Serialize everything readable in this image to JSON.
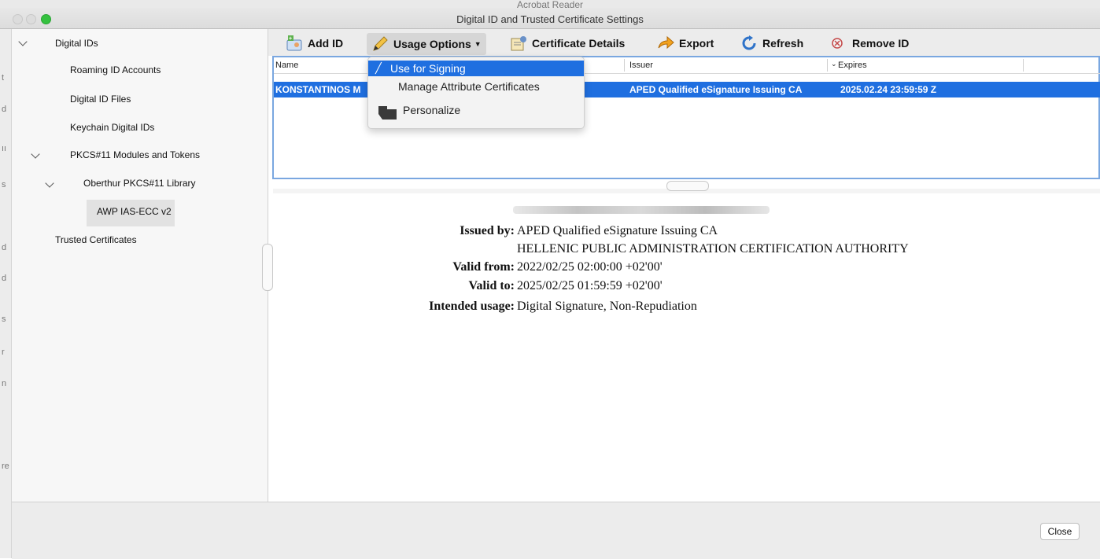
{
  "window": {
    "background_app_title": "Acrobat Reader",
    "title": "Digital ID and Trusted Certificate Settings"
  },
  "left_strip_chars": [
    "t",
    "d",
    "ıı",
    "s",
    "d",
    "d",
    "s",
    "r",
    "n",
    "re"
  ],
  "sidebar": {
    "items": [
      {
        "label": "Digital IDs"
      },
      {
        "label": "Roaming ID Accounts"
      },
      {
        "label": "Digital ID Files"
      },
      {
        "label": "Keychain Digital IDs"
      },
      {
        "label": "PKCS#11 Modules and Tokens"
      },
      {
        "label": "Oberthur PKCS#11 Library"
      },
      {
        "label": "AWP IAS-ECC v2"
      },
      {
        "label": "Trusted Certificates"
      }
    ]
  },
  "toolbar": {
    "add_id": "Add ID",
    "usage_options": "Usage Options",
    "certificate_details": "Certificate Details",
    "export": "Export",
    "refresh": "Refresh",
    "remove_id": "Remove ID"
  },
  "list": {
    "columns": [
      "Name",
      "Issuer",
      "Expires"
    ],
    "rows": [
      {
        "name": "KONSTANTINOS M",
        "issuer": "APED Qualified eSignature Issuing CA",
        "expires": "2025.02.24 23:59:59 Z"
      }
    ]
  },
  "menu": {
    "items": [
      "Use for Signing",
      "Manage Attribute Certificates",
      "Personalize"
    ]
  },
  "details": {
    "issued_by_label": "Issued by:",
    "issued_by_1": "APED Qualified eSignature Issuing CA",
    "issued_by_2": "HELLENIC PUBLIC ADMINISTRATION CERTIFICATION AUTHORITY",
    "valid_from_label": "Valid from:",
    "valid_from": "2022/02/25 02:00:00 +02'00'",
    "valid_to_label": "Valid to:",
    "valid_to": "2025/02/25 01:59:59 +02'00'",
    "usage_label": "Intended usage:",
    "usage": "Digital Signature, Non-Repudiation"
  },
  "footer": {
    "close": "Close"
  },
  "colors": {
    "selection": "#1f6fe0",
    "focus_ring": "#7aa7e0"
  }
}
